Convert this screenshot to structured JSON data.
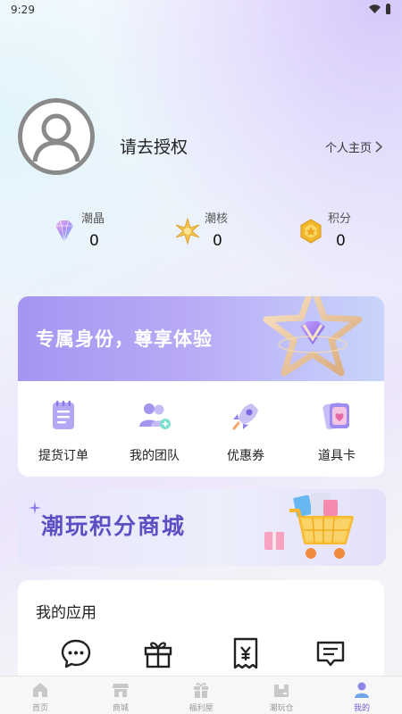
{
  "status_bar": {
    "time": "9:29"
  },
  "profile": {
    "username": "请去授权",
    "profile_link": "个人主页"
  },
  "stats": [
    {
      "icon": "diamond-icon",
      "label": "潮晶",
      "value": "0"
    },
    {
      "icon": "star-core-icon",
      "label": "潮核",
      "value": "0"
    },
    {
      "icon": "points-coin-icon",
      "label": "积分",
      "value": "0"
    }
  ],
  "banner": {
    "text": "专属身份，尊享体验"
  },
  "quick_actions": [
    {
      "icon": "order-list-icon",
      "label": "提货订单"
    },
    {
      "icon": "team-icon",
      "label": "我的团队"
    },
    {
      "icon": "coupon-rocket-icon",
      "label": "优惠券"
    },
    {
      "icon": "prop-card-icon",
      "label": "道具卡"
    }
  ],
  "points_mall": {
    "title": "潮玩积分商城"
  },
  "my_apps": {
    "title": "我的应用",
    "items": [
      {
        "icon": "chat-bubble-icon"
      },
      {
        "icon": "gift-icon"
      },
      {
        "icon": "yuan-receipt-icon"
      },
      {
        "icon": "message-box-icon"
      }
    ]
  },
  "tabbar": [
    {
      "icon": "home-icon",
      "label": "首页",
      "active": false
    },
    {
      "icon": "store-icon",
      "label": "商城",
      "active": false
    },
    {
      "icon": "gift-box-icon",
      "label": "福利屋",
      "active": false
    },
    {
      "icon": "warehouse-icon",
      "label": "潮玩仓",
      "active": false
    },
    {
      "icon": "user-icon",
      "label": "我的",
      "active": true
    }
  ],
  "colors": {
    "accent": "#6d62d9",
    "banner_start": "#a595f2",
    "mall_title": "#5e4ec4"
  }
}
